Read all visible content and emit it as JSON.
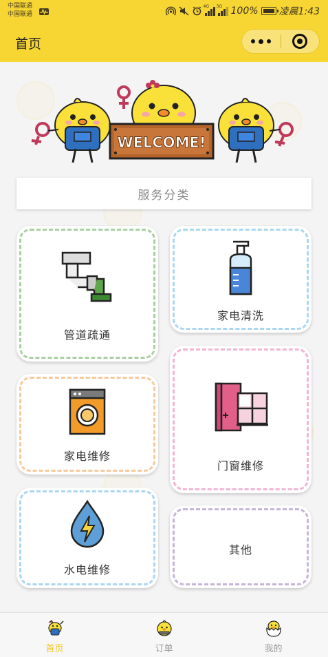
{
  "status_bar": {
    "carrier_1": "中国联通",
    "carrier_2": "中国联通",
    "network_1": "4G",
    "network_2": "3G",
    "battery_percent": "100%",
    "time": "凌晨1:43"
  },
  "header": {
    "title": "首页",
    "menu_icon": "more-dots-icon",
    "close_icon": "target-ring-icon"
  },
  "banner": {
    "sign_text": "WELCOME!",
    "image": "three-yellow-chicks-welcome-banner"
  },
  "category_header": "服务分类",
  "services": [
    {
      "label": "管道疏通",
      "icon": "pipe-icon",
      "border_color": "#a8cfa0"
    },
    {
      "label": "家电清洗",
      "icon": "spray-bottle-icon",
      "border_color": "#a9d6f2"
    },
    {
      "label": "家电维修",
      "icon": "washing-machine-icon",
      "border_color": "#f7c99a"
    },
    {
      "label": "门窗维修",
      "icon": "door-window-icon",
      "border_color": "#f2b3d4"
    },
    {
      "label": "水电维修",
      "icon": "water-electric-drop-icon",
      "border_color": "#a9d6f2"
    },
    {
      "label": "其他",
      "icon": "",
      "border_color": "#c6b4d6"
    }
  ],
  "tab_bar": {
    "tabs": [
      {
        "label": "首页",
        "icon": "chick-worker-icon",
        "active": true
      },
      {
        "label": "订单",
        "icon": "chick-face-icon",
        "active": false
      },
      {
        "label": "我的",
        "icon": "chick-egg-icon",
        "active": false
      }
    ],
    "active_color": "#f5c518"
  }
}
